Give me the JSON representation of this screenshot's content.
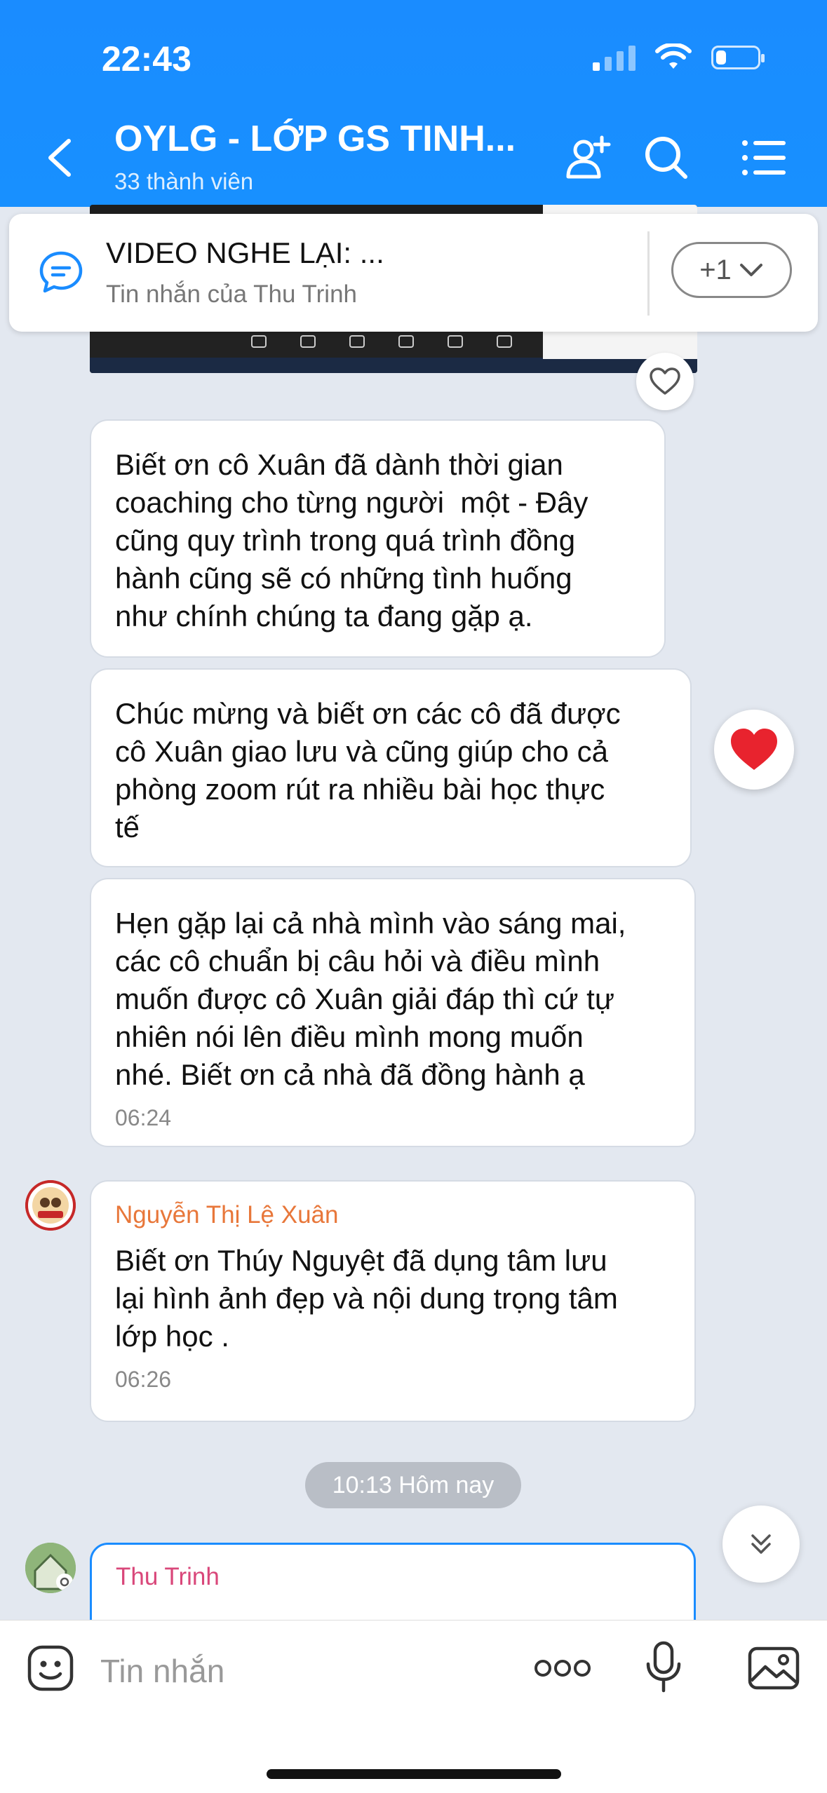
{
  "status_bar": {
    "time": "22:43"
  },
  "header": {
    "title": "OYLG - LỚP GS TINH...",
    "subtitle": "33 thành viên"
  },
  "pinned": {
    "title": "VIDEO NGHE LẠI: ...",
    "subtitle": "Tin nhắn của Thu Trinh",
    "more_label": "+1"
  },
  "messages": [
    {
      "text": "Biết ơn cô Xuân đã dành thời gian\ncoaching cho từng người  một - Đây\ncũng quy trình trong quá trình đồng\nhành cũng sẽ có những tình huống\nnhư chính chúng ta đang gặp ạ."
    },
    {
      "text": "Chúc mừng và biết ơn các cô đã được\ncô Xuân giao lưu và cũng giúp cho cả\nphòng zoom rút ra nhiều bài học thực\ntế"
    },
    {
      "text": "Hẹn gặp lại cả nhà mình vào sáng mai,\ncác cô chuẩn bị câu hỏi và điều mình\nmuốn được cô Xuân giải đáp thì cứ tự\nnhiên nói lên điều mình mong muốn\nnhé. Biết ơn cả nhà đã đồng hành ạ",
      "time": "06:24"
    },
    {
      "sender": "Nguyễn Thị Lệ Xuân",
      "text": "Biết ơn Thúy Nguyệt đã dụng tâm lưu\nlại hình ảnh đẹp và nội dung trọng tâm\nlớp học .",
      "time": "06:26"
    },
    {
      "sender": "Thu Trinh"
    }
  ],
  "date_separator": "10:13 Hôm nay",
  "composer": {
    "placeholder": "Tin nhắn"
  },
  "colors": {
    "header": "#1890ff",
    "sender_orange": "#e8773a",
    "sender_pink": "#d9477a",
    "heart": "#e8232e"
  }
}
